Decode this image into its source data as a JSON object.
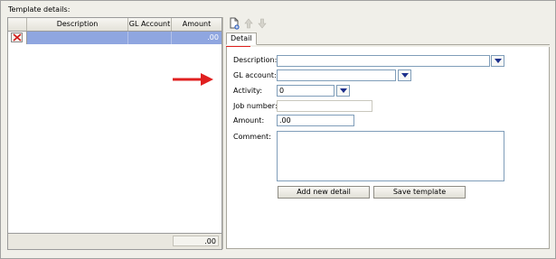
{
  "template_details": {
    "title": "Template details:",
    "columns": [
      "",
      "Description",
      "GL Account",
      "Amount"
    ],
    "rows": [
      {
        "description": "",
        "gl_account": "",
        "amount": ".00"
      }
    ],
    "footer_total": ".00"
  },
  "toolbar": {
    "icons": [
      "new-icon",
      "up-arrow-icon",
      "down-arrow-icon"
    ]
  },
  "tabs": [
    {
      "label": "Detail",
      "active": true
    }
  ],
  "form": {
    "description_label": "Description:",
    "description_value": "",
    "gl_account_label": "GL account:",
    "gl_account_value": "",
    "activity_label": "Activity:",
    "activity_value": "0",
    "job_number_label": "Job number:",
    "job_number_value": "",
    "amount_label": "Amount:",
    "amount_value": ".00",
    "comment_label": "Comment:",
    "comment_value": "",
    "add_button": "Add new detail",
    "save_button": "Save template"
  },
  "colors": {
    "selected_row": "#8fa6e0",
    "callout_arrow": "#e02020",
    "dropdown_arrow": "#1c2f8c"
  }
}
